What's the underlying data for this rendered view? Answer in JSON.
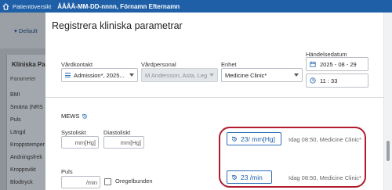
{
  "topbar": {
    "section": "Patientöversikt",
    "patient": "ÅÅÅÅ-MM-DD-nnnn, Förnamn Efternamn"
  },
  "background": {
    "default_label": "Default",
    "panel_title": "Kliniska Pa",
    "column_header": "Parameter",
    "items": [
      "BMI",
      "Smärta (NRS",
      "Puls",
      "Längd",
      "Kroppstemper",
      "Andningsfrek",
      "Kroppsvikt",
      "Blodtryck"
    ]
  },
  "dialog": {
    "title": "Registrera kliniska parametrar",
    "fields": {
      "vardkontakt": {
        "label": "Vårdkontakt",
        "value": "Admission*, 2025..."
      },
      "vardpersonal": {
        "label": "Vårdpersonal",
        "value": "M Andersson, Asta, Leg l..."
      },
      "enhet": {
        "label": "Enhet",
        "value": "Medicine Clinic*"
      },
      "handelse": {
        "label": "Händelsedatum",
        "date": "2025 - 08 - 29",
        "time": "11 : 33"
      }
    },
    "mews": {
      "label": "MEWS"
    },
    "systoliskt": {
      "label": "Systoliskt",
      "unit": "mm[Hg]"
    },
    "diastoliskt": {
      "label": "Diastoliskt",
      "unit": "mm[Hg]"
    },
    "puls": {
      "label": "Puls",
      "unit": "/min",
      "checkbox_label": "Oregelbunden"
    },
    "bp_last": {
      "value": "23/ mm[Hg]",
      "meta": "Idag 08:50, Medicine Clinic*"
    },
    "pulse_last": {
      "value": "23 /min",
      "meta": "Idag 08:50, Medicine Clinic*"
    }
  },
  "colors": {
    "brand": "#1e5fa8",
    "highlight": "#b01c2e"
  }
}
